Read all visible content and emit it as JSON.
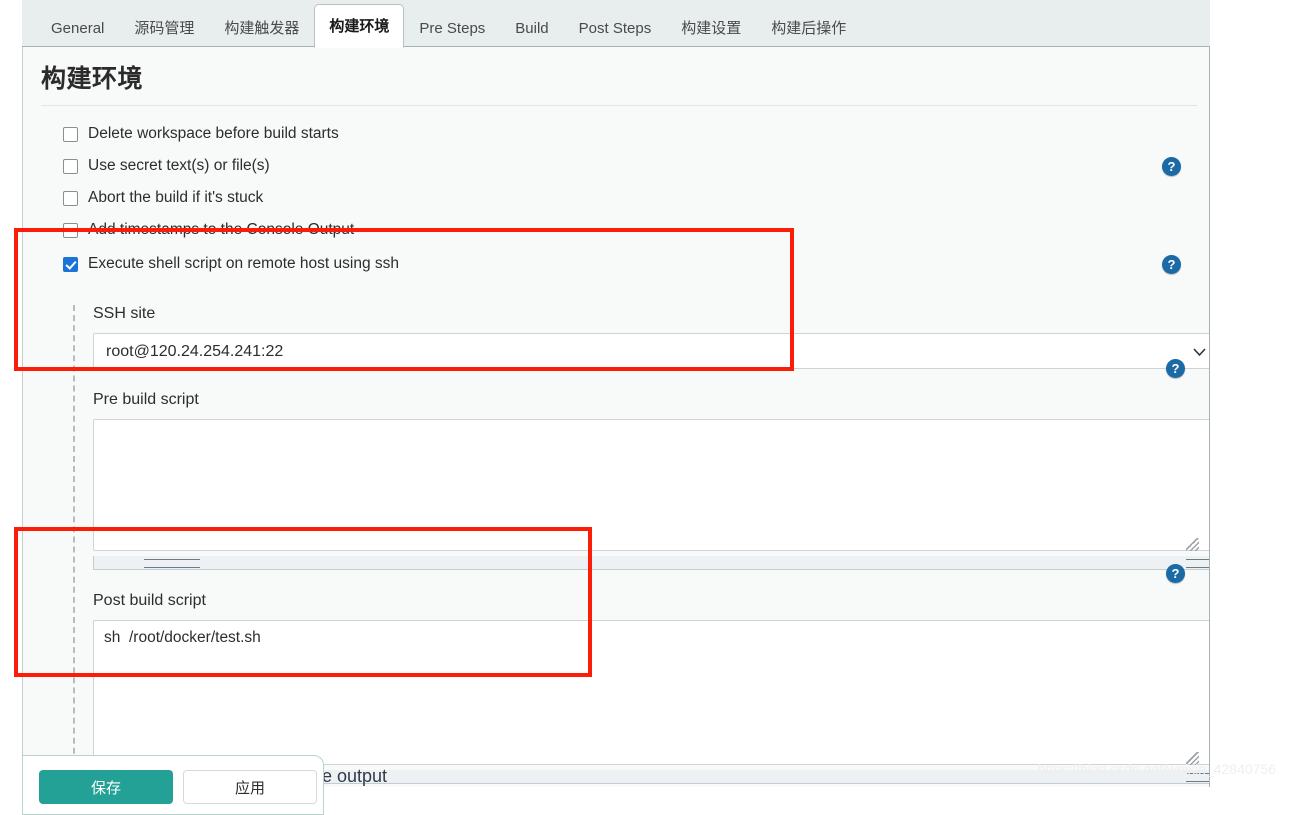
{
  "tabs": [
    {
      "label": "General",
      "active": false
    },
    {
      "label": "源码管理",
      "active": false
    },
    {
      "label": "构建触发器",
      "active": false
    },
    {
      "label": "构建环境",
      "active": true
    },
    {
      "label": "Pre Steps",
      "active": false
    },
    {
      "label": "Build",
      "active": false
    },
    {
      "label": "Post Steps",
      "active": false
    },
    {
      "label": "构建设置",
      "active": false
    },
    {
      "label": "构建后操作",
      "active": false
    }
  ],
  "section": {
    "title": "构建环境"
  },
  "checkboxes": [
    {
      "label": "Delete workspace before build starts",
      "checked": false,
      "help": false
    },
    {
      "label": "Use secret text(s) or file(s)",
      "checked": false,
      "help": true
    },
    {
      "label": "Abort the build if it's stuck",
      "checked": false,
      "help": false
    },
    {
      "label": "Add timestamps to the Console Output",
      "checked": false,
      "help": false
    },
    {
      "label": "Execute shell script on remote host using ssh",
      "checked": true,
      "help": true
    }
  ],
  "ssh": {
    "site_label": "SSH site",
    "site_value": "root@120.24.254.241:22",
    "pre_build_label": "Pre build script",
    "pre_build_value": "",
    "post_build_label": "Post build script",
    "post_build_value": "sh  /root/docker/test.sh",
    "help_glyph": "?"
  },
  "icons": {
    "chevron_down": "⌄",
    "help": "?"
  },
  "savebar": {
    "save_label": "保存",
    "apply_label": "应用"
  },
  "occluded_text": "e output",
  "watermark": "https://blog.csdn.net/weixin_42840756",
  "colors": {
    "accent_blue": "#1a73d6",
    "help_blue": "#1b6aa5",
    "annotation_red": "#fb1d07",
    "save_teal": "#23a197",
    "tabbar_bg": "#e8edee",
    "panel_bg": "#f8f9f9"
  }
}
